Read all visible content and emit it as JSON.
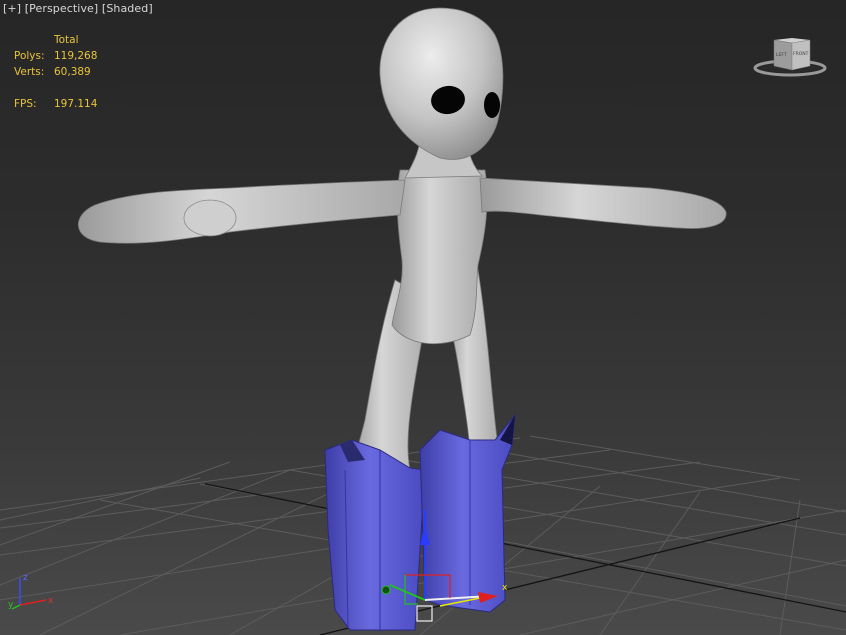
{
  "viewport": {
    "menu_plus": "[+]",
    "view_mode": "[Perspective]",
    "shading_mode": "[Shaded]"
  },
  "stats": {
    "header": "Total",
    "polys_label": "Polys:",
    "polys_value": "119,268",
    "verts_label": "Verts:",
    "verts_value": "60,389",
    "fps_label": "FPS:",
    "fps_value": "197.114"
  },
  "viewcube": {
    "left_face": "LEFT",
    "front_face": "FRONT"
  },
  "tripod": {
    "x": "x",
    "y": "y",
    "z": "z"
  },
  "gizmo": {
    "x": "x"
  },
  "colors": {
    "stats_text": "#e8c43a",
    "label_text": "#d8d8d8",
    "grid_line": "#5a5a5a",
    "grid_axis": "#111111",
    "model_gray": "#c8c8c8",
    "boot_blue": "#5f5fd6",
    "axis_x": "#e02020",
    "axis_y": "#20c020",
    "axis_z": "#3030ff"
  }
}
